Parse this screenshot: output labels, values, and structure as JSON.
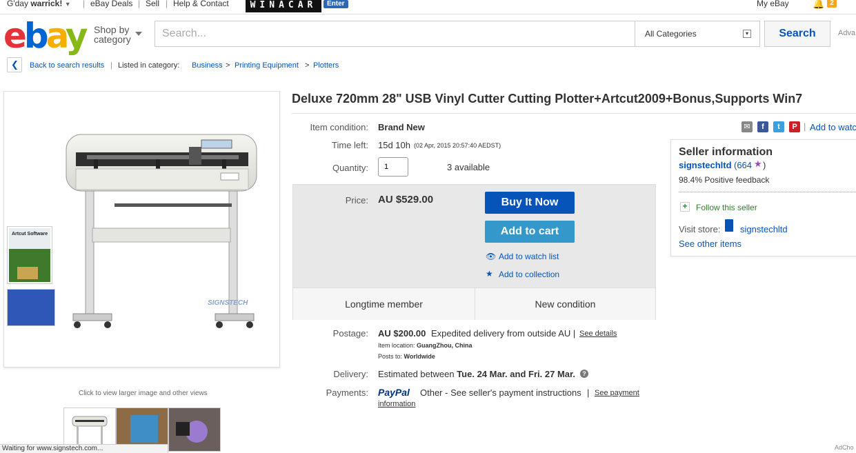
{
  "topnav": {
    "greeting": "G'day",
    "user": "warrick!",
    "deals": "eBay Deals",
    "sell": "Sell",
    "help": "Help & Contact",
    "ad_brand": "WINACAR",
    "ad_enter": "Enter",
    "my_ebay": "My eBay",
    "notifications": "2"
  },
  "header": {
    "shop_by_line1": "Shop by",
    "shop_by_line2": "category",
    "search_placeholder": "Search...",
    "category": "All Categories",
    "search_button": "Search",
    "advanced": "Adva"
  },
  "breadcrumb": {
    "back": "Back to search results",
    "listed_in": "Listed in category:",
    "items": [
      "Business",
      "Printing Equipment",
      "Plotters"
    ],
    "separator": ">"
  },
  "gallery": {
    "brand_watermark": "SIGNSTECH",
    "box_label": "Artcut Software",
    "click_hint": "Click to view larger image and other views"
  },
  "listing": {
    "title": "Deluxe 720mm 28\" USB Vinyl Cutter Cutting Plotter+Artcut2009+Bonus,Supports Win7",
    "condition_label": "Item condition:",
    "condition_value": "Brand New",
    "time_left_label": "Time left:",
    "time_left_value": "15d 10h",
    "time_left_detail": "(02 Apr, 2015   20:57:40 AEDST)",
    "quantity_label": "Quantity:",
    "quantity_value": "1",
    "available": "3 available",
    "price_label": "Price:",
    "price_value": "AU $529.00",
    "buy_now": "Buy It Now",
    "add_to_cart": "Add to cart",
    "add_watch": "Add to watch list",
    "add_collection": "Add to collection",
    "feature_1": "Longtime member",
    "feature_2": "New condition",
    "postage_label": "Postage:",
    "postage_value": "AU $200.00",
    "postage_desc": "Expedited delivery from outside AU |",
    "see_details": "See details",
    "item_location_label": "Item location:",
    "item_location": "GuangZhou, China",
    "posts_to_label": "Posts to:",
    "posts_to": "Worldwide",
    "delivery_label": "Delivery:",
    "delivery_prefix": "Estimated between",
    "delivery_from": "Tue. 24 Mar.",
    "delivery_and": "and",
    "delivery_to": "Fri. 27 Mar.",
    "payments_label": "Payments:",
    "paypal": "PayPal",
    "payments_desc": "Other - See seller's payment instructions",
    "see_payment_1": "See payment",
    "see_payment_2": "information",
    "add_to_watch_short": "Add to watc"
  },
  "seller": {
    "heading": "Seller information",
    "name": "signstechltd",
    "feedback_count": "(664",
    "feedback_close": ")",
    "positive": "98.4% Positive feedback",
    "follow": "Follow this seller",
    "visit_store": "Visit store:",
    "store_name": "signstechltd",
    "see_other": "See other items"
  },
  "status": {
    "loading": "Waiting for www.signstech.com...",
    "adchoices": "AdCho"
  },
  "colors": {
    "link": "#0654ba",
    "buy_now": "#0654ba",
    "add_to_cart": "#3498ca",
    "ebay_e": "#e53238",
    "ebay_b": "#0064d2",
    "ebay_a": "#f5af02",
    "ebay_y": "#86b817"
  }
}
